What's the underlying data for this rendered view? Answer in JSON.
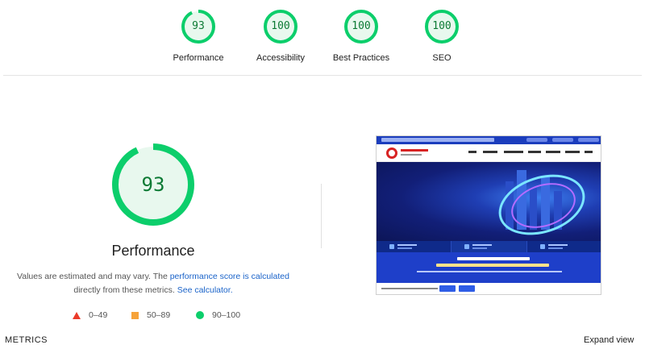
{
  "top_scores": [
    {
      "label": "Performance",
      "score": "93",
      "fraction": 0.93
    },
    {
      "label": "Accessibility",
      "score": "100",
      "fraction": 1.0
    },
    {
      "label": "Best Practices",
      "score": "100",
      "fraction": 1.0
    },
    {
      "label": "SEO",
      "score": "100",
      "fraction": 1.0
    }
  ],
  "main": {
    "score": "93",
    "fraction": 0.93,
    "title": "Performance",
    "desc_prefix": "Values are estimated and may vary. The ",
    "desc_link1": "performance score is calculated",
    "desc_middle": " directly from these metrics. ",
    "desc_link2": "See calculator.",
    "legend": [
      {
        "shape": "triangle",
        "range": "0–49"
      },
      {
        "shape": "square",
        "range": "50–89"
      },
      {
        "shape": "circle",
        "range": "90–100"
      }
    ]
  },
  "colors": {
    "pass": "#0cce6b",
    "pass_text": "#0c7a34",
    "pass_fill": "#e8f8ee",
    "average": "#f6a33a",
    "fail": "#eb3b2a",
    "link": "#1a63c9"
  },
  "footer": {
    "metrics_label": "METRICS",
    "expand_label": "Expand view"
  }
}
